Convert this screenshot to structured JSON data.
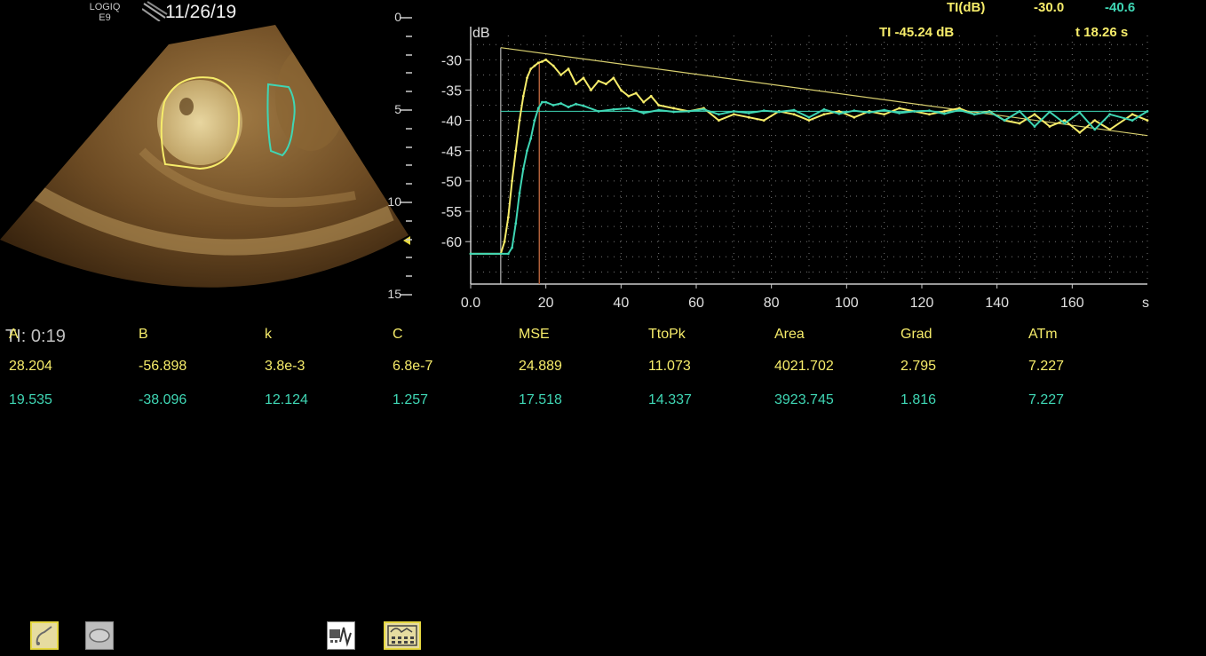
{
  "header": {
    "logo_line1": "LOGIQ",
    "logo_line2": "E9",
    "date": "11/26/19"
  },
  "depth_scale": {
    "labels": [
      "0",
      "5",
      "10",
      "15"
    ]
  },
  "readout": {
    "ti_label": "TI(dB)",
    "ti_yellow": "-30.0",
    "ti_cyan": "-40.6",
    "ti_cursor": "TI -45.24 dB",
    "t_cursor": "t 18.26 s"
  },
  "chart_data": {
    "type": "line",
    "ylabel": "dB",
    "xlabel": "s",
    "xlim": [
      0,
      180
    ],
    "ylim": [
      -67,
      -26
    ],
    "x_ticks": [
      0.0,
      20,
      40,
      60,
      80,
      100,
      120,
      140,
      160
    ],
    "x_tick_labels": [
      "0.0",
      "20",
      "40",
      "60",
      "80",
      "100",
      "120",
      "140",
      "160"
    ],
    "y_ticks": [
      -30,
      -35,
      -40,
      -45,
      -50,
      -55,
      -60
    ],
    "y_tick_labels": [
      "-30",
      "-35",
      "-40",
      "-45",
      "-50",
      "-55",
      "-60"
    ],
    "grid": true,
    "cursor_x": 18.26,
    "series": [
      {
        "color": "#f6ec6a",
        "x": [
          0,
          8,
          9,
          10,
          11,
          12,
          13,
          14,
          15,
          16,
          17,
          18,
          19,
          20,
          22,
          24,
          26,
          28,
          30,
          32,
          34,
          36,
          38,
          40,
          42,
          44,
          46,
          48,
          50,
          54,
          58,
          62,
          66,
          70,
          74,
          78,
          82,
          86,
          90,
          94,
          98,
          102,
          106,
          110,
          114,
          118,
          122,
          126,
          130,
          134,
          138,
          142,
          146,
          150,
          154,
          158,
          162,
          166,
          170,
          176,
          180
        ],
        "y": [
          -62,
          -62,
          -60,
          -56,
          -50,
          -45,
          -40,
          -36,
          -33,
          -31.5,
          -31,
          -30.5,
          -30.3,
          -30,
          -31,
          -32.5,
          -31.5,
          -34,
          -33,
          -35,
          -33.5,
          -34,
          -33,
          -35,
          -36,
          -35.5,
          -37,
          -36,
          -37.5,
          -38,
          -38.5,
          -38,
          -40,
          -39,
          -39.5,
          -40,
          -38.5,
          -39,
          -40,
          -39,
          -38.5,
          -39.5,
          -38.5,
          -39,
          -38,
          -38.5,
          -39,
          -38.5,
          -38,
          -39,
          -38.5,
          -40,
          -40.5,
          -39,
          -41,
          -40,
          -42,
          -40,
          -41.5,
          -39,
          -40
        ]
      },
      {
        "color": "#3fd6b4",
        "x": [
          0,
          10,
          11,
          12,
          13,
          14,
          15,
          16,
          17,
          18,
          19,
          20,
          22,
          24,
          26,
          28,
          30,
          34,
          38,
          42,
          46,
          50,
          54,
          58,
          62,
          66,
          70,
          74,
          78,
          82,
          86,
          90,
          94,
          98,
          102,
          106,
          110,
          114,
          118,
          122,
          126,
          130,
          134,
          138,
          142,
          146,
          150,
          154,
          158,
          162,
          166,
          170,
          176,
          180
        ],
        "y": [
          -62,
          -62,
          -61,
          -57,
          -52,
          -48,
          -45,
          -43,
          -40,
          -38,
          -37,
          -37,
          -37.5,
          -37.2,
          -37.8,
          -37.3,
          -37.6,
          -38.5,
          -38.2,
          -38,
          -38.8,
          -38.3,
          -38.6,
          -38.5,
          -38.2,
          -39,
          -38.5,
          -38.8,
          -38.4,
          -38.6,
          -38.3,
          -39.5,
          -38.2,
          -38.9,
          -38.4,
          -38.7,
          -38.3,
          -38.8,
          -38.5,
          -38.4,
          -38.9,
          -38.3,
          -39,
          -38.6,
          -40,
          -38.5,
          -41,
          -38.6,
          -40.5,
          -38.7,
          -41.5,
          -39,
          -40,
          -38.5
        ]
      }
    ],
    "fit_line": {
      "color": "#d8cf6e",
      "x": [
        8,
        180
      ],
      "y": [
        -28,
        -42.5
      ]
    },
    "baseline": {
      "color": "#3fd6b4",
      "y": -38.5
    }
  },
  "params": {
    "timer": "TI: 0:19",
    "columns": [
      "A",
      "B",
      "k",
      "C",
      "MSE",
      "TtoPk",
      "Area",
      "Grad",
      "ATm"
    ],
    "row_yellow": [
      "28.204",
      "-56.898",
      "3.8e-3",
      "6.8e-7",
      "24.889",
      "11.073",
      "4021.702",
      "2.795",
      "7.227"
    ],
    "row_cyan": [
      "19.535",
      "-38.096",
      "12.124",
      "1.257",
      "17.518",
      "14.337",
      "3923.745",
      "1.816",
      "7.227"
    ]
  },
  "toolbar": {
    "icons": [
      "trace-roi-icon",
      "ellipse-roi-icon",
      "curve-fit-icon",
      "table-display-icon"
    ]
  }
}
